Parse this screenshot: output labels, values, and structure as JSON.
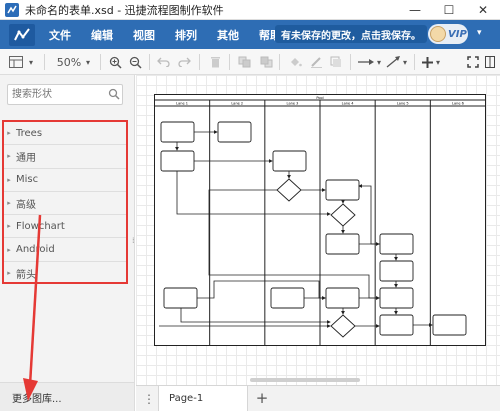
{
  "window": {
    "title": "未命名的表单.xsd - 迅捷流程图制作软件",
    "min_symbol": "—",
    "max_symbol": "☐",
    "close_symbol": "✕"
  },
  "menubar": {
    "items": [
      "文件",
      "编辑",
      "视图",
      "排列",
      "其他",
      "帮助"
    ],
    "save_notice": "有未保存的更改，点击我保存。",
    "vip_label": "VIP",
    "caret": "▾"
  },
  "toolbar": {
    "zoom": "50%",
    "zoom_caret": "▾",
    "more_caret": "▾"
  },
  "sidebar": {
    "search_placeholder": "搜索形状",
    "groups": [
      {
        "label": "Trees"
      },
      {
        "label": "通用"
      },
      {
        "label": "Misc"
      },
      {
        "label": "高级"
      },
      {
        "label": "Flowchart"
      },
      {
        "label": "Android"
      },
      {
        "label": "箭头"
      }
    ],
    "caret": "▸",
    "more_libraries": "更多图库..."
  },
  "diagram": {
    "pool_title": "Pool",
    "lanes": [
      "Lane 1",
      "Lane 2",
      "Lane 3",
      "Lane 4",
      "Lane 5",
      "Lane 6"
    ]
  },
  "pages": {
    "menu_symbol": "⋮",
    "tabs": [
      {
        "label": "Page-1"
      }
    ],
    "add_symbol": "+"
  },
  "colors": {
    "menubar_bg": "#2e6db4",
    "highlight_border": "#e53935",
    "arrow": "#e53935"
  }
}
